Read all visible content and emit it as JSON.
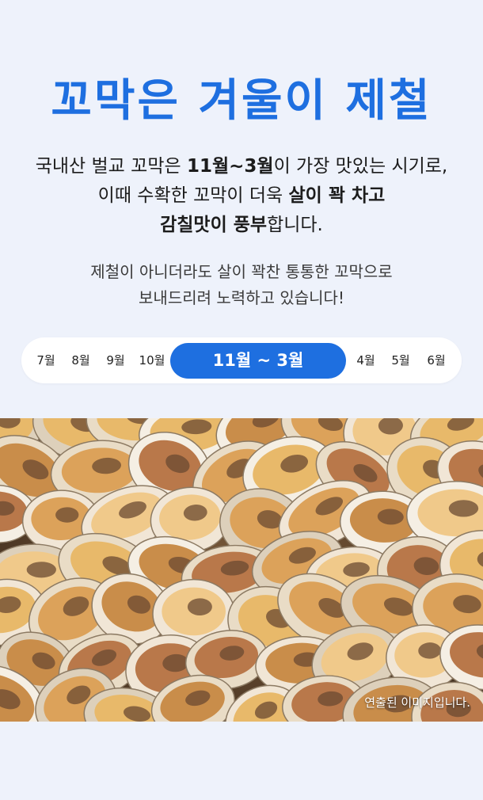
{
  "headline": "꼬막은 겨울이 제철",
  "description": {
    "line1_a": "국내산 벌교 꼬막은 ",
    "line1_b": "11월~3월",
    "line1_c": "이 가장 맛있는 시기로,",
    "line2_a": "이때 수확한 꼬막이 더욱 ",
    "line2_b": "살이 꽉 차고",
    "line3_a": "감칠맛이 풍부",
    "line3_b": "합니다."
  },
  "note": {
    "line1": "제철이 아니더라도 살이 꽉찬 통통한 꼬막으로",
    "line2": "보내드리려 노력하고 있습니다!"
  },
  "months": {
    "m7": "7월",
    "m8": "8월",
    "m9": "9월",
    "m10": "10월",
    "season": "11월 ~ 3월",
    "m4": "4월",
    "m5": "5월",
    "m6": "6월"
  },
  "photo": {
    "caption": "연출된 이미지입니다."
  }
}
